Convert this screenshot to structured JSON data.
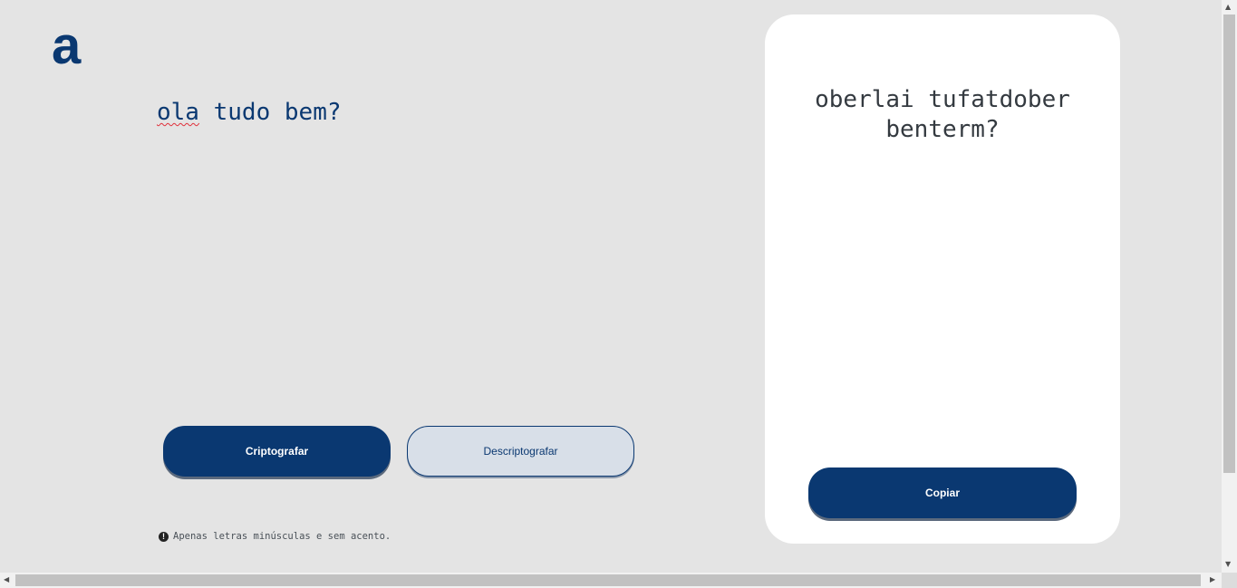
{
  "logo": {
    "glyph": "a"
  },
  "input": {
    "text_underlined": "ola",
    "text_rest": " tudo bem?"
  },
  "buttons": {
    "encrypt_label": "Criptografar",
    "decrypt_label": "Descriptografar",
    "copy_label": "Copiar"
  },
  "hint": {
    "icon": "!",
    "text": "Apenas letras minúsculas e sem acento."
  },
  "output": {
    "text": "oberlai tufatdober benterm?"
  },
  "scrollbars": {
    "up": "▲",
    "down": "▼",
    "left": "◀",
    "right": "▶"
  },
  "colors": {
    "primary": "#0a3871",
    "background": "#e4e4e4",
    "panel": "#ffffff"
  }
}
